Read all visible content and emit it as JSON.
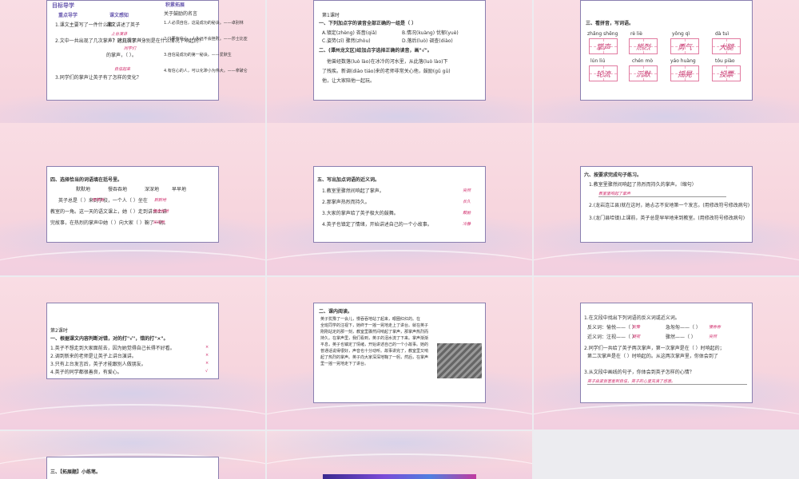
{
  "slide1": {
    "title": "目标导学",
    "col1_head": "重点导学",
    "col1_items": [
      "1.课文主要写了一件什么事？",
      "2.文中一共出现了几次掌声？这几次掌声分别是在什么情况下响起的？",
      "3.同学们的掌声让英子有了怎样的变化？"
    ],
    "col2_head": "课文感知",
    "col2_text": [
      "课文讲述了英子",
      "（ ）时获得了（ ）",
      "的掌声，（ ）。"
    ],
    "col2_answers": [
      "上台演讲",
      "同学们",
      "自信起来"
    ],
    "col3_head": "积累拓展",
    "col3_items": [
      "关于鼓励的名言",
      "1.人必须自信，这是成功的秘诀。——卓别林",
      "2.只要有信心，人永远不会挫败。——莎士比亚",
      "3.自信是成功的第一秘诀。——爱默生",
      "4.有信心的人，可以化渺小为伟大。——拿破仑"
    ]
  },
  "slide2": {
    "lesson": "第1课时",
    "q1": "一、下列加点字的读音全部正确的一组是（  ）",
    "opts": [
      "A.镇定(zhèng)  吝啬(qiǎ)",
      "B.情况(kuàng)  忧郁(yuè)",
      "C.姿势(zī)  骤然(zhòu)",
      "D.落后(luò)  调查(diào)"
    ],
    "q2": "二、(谭州龙文区)给加点字选择正确的读音，画\"√\"。",
    "para": [
      "他曾经数落(luò  lào)在冰冷的河水里，从此落(luò  lào)下",
      "了残疾。新调(diào  tiáo)来的老师非常关心他，鼓励(gǔ  gū)",
      "他，让大家陪他一起玩。"
    ]
  },
  "slide3": {
    "title": "三、看拼音，写词语。",
    "row1_pinyin": [
      "zhǎng shēng",
      "rè  liè",
      "yǒng  qì",
      "dà  tuì"
    ],
    "row1_words": [
      "掌声",
      "热烈",
      "勇气",
      "大腿"
    ],
    "row2_pinyin": [
      "lún  liú",
      "chén  mò",
      "yáo huàng",
      "tóu  piào"
    ],
    "row2_words": [
      "轮流",
      "沉默",
      "摇晃",
      "投票"
    ]
  },
  "slide4": {
    "title": "四、选择恰当的词语填在括号里。",
    "choices": [
      "默默地",
      "慢吞吞地",
      "深深地",
      "早早地"
    ],
    "text": [
      "英子总是（         ）来到学校，一个人（         ）坐在",
      "教室的一角。这一天的语文课上，她（         ）走到讲台上讲",
      "完故事，在热烈的掌声中她（         ）向大家（         ）鞠了一躬。"
    ],
    "answers": [
      "早早地",
      "默默地",
      "慢吞吞地",
      "深深地"
    ]
  },
  "slide5": {
    "title": "五、写出加点词语的近义词。",
    "items": [
      "1.教室里骤然间响起了掌声。",
      "2.那掌声热烈而持久。",
      "3.大家的掌声给了英子极大的鼓舞。",
      "4.英子也镇定了情绪，开始讲述自己的一个小故事。"
    ],
    "answers": [
      "突然",
      "长久",
      "鼓励",
      "冷静"
    ]
  },
  "slide6": {
    "title": "六、按要求完成句子练习。",
    "items": [
      "1.教室里骤然间响起了热烈而持久的掌声。（缩句）",
      "2.(龙岩连江县)就在这时，她忐忑不安地第一个发言。(用修改符号修改病句)",
      "3.(龙门县哈镇)上课前，英子总是早早地来到教室。(用修改符号修改病句)"
    ],
    "answer": "教室里响起了掌声"
  },
  "slide7": {
    "lesson": "第2课时",
    "title": "一、根据课文内容判断对错，对的打\"√\"，错的打\"×\"。",
    "items": [
      "1.英子不想走到大家面前去，因为她觉得自己长得不好看。",
      "2.调到新来的老师是让英子上讲台演讲。",
      "3.只有上台发言后，英子才能跟别人做朋友。",
      "4.英子的同学都很善良，有爱心。"
    ],
    "marks": [
      "×",
      "×",
      "×",
      "√"
    ]
  },
  "slide8": {
    "title": "二、课内阅读。",
    "passage": [
      "英子犹豫了一会儿，慢吞吞地站了起来，眼圈红红的。在",
      "全班同学的注视下，她终于一摇一晃地走上了讲台。就在英子",
      "刚刚站定的那一刻，教室里骤然间响起了掌声，那掌声热烈而",
      "持久。在掌声里，我们看到，英子的泪水流了下来。掌声渐渐",
      "平息，英子也镇定了情绪，开始讲述自己的一个小故事。她的",
      "普通话说得很好，声音也十分动听。故事讲完了，教室里又响",
      "起了热烈的掌声。英子向大家深深地鞠了一躬，然后，在掌声",
      "里一摇一晃地走下了讲台。"
    ]
  },
  "slide9": {
    "q1": "1.在文段中找出下列词语的反义词或近义词。",
    "row1": [
      "反义词：愉悦——（     ）",
      "急匆匆——（     ）"
    ],
    "row1_ans": [
      "犹豫",
      "慢吞吞"
    ],
    "row2": [
      "近义词：注视——（     ）",
      "骤然——（     ）"
    ],
    "row2_ans": [
      "凝视",
      "突然"
    ],
    "q2": "2.同学们一共给了英子两次掌声，第一次掌声是在（            ）时响起的；",
    "q2b": "第二次掌声是在（            ）时响起的。从这两次掌声里，你体会到了",
    "q3": "3.从文段中画线的句子，你体会到英子怎样的心情？",
    "q3_ans": "英子由紧张害羞到自信，英子的心里充满了感激。"
  },
  "slide10": {
    "title": "三、【拓展题】小练笔。"
  }
}
